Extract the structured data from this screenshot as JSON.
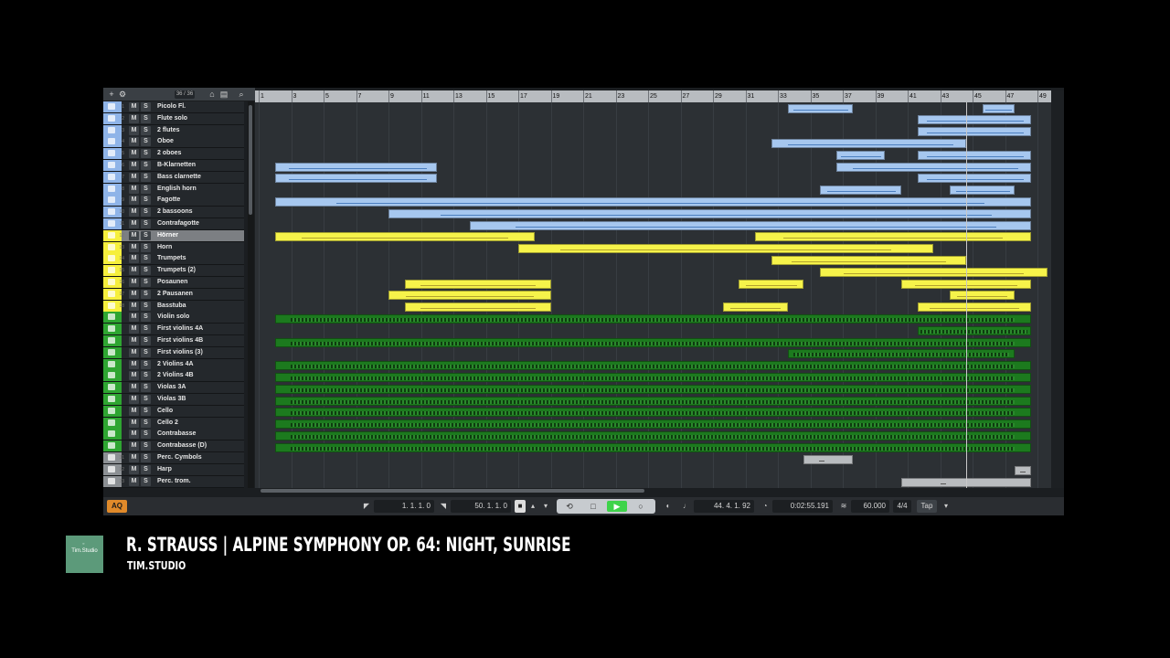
{
  "tracklist": {
    "header": {
      "add_label": "+",
      "track_count": "36 / 36",
      "search_icon": "search-icon"
    },
    "tracks": [
      {
        "num": "1",
        "name": "Picolo Fl.",
        "group": "wood"
      },
      {
        "num": "2",
        "name": "Flute solo",
        "group": "wood"
      },
      {
        "num": "3",
        "name": "2 flutes",
        "group": "wood"
      },
      {
        "num": "4",
        "name": "Oboe",
        "group": "wood"
      },
      {
        "num": "5",
        "name": "2 oboes",
        "group": "wood"
      },
      {
        "num": "6",
        "name": "B-Klarnetten",
        "group": "wood"
      },
      {
        "num": "7",
        "name": "Bass clarnette",
        "group": "wood"
      },
      {
        "num": "8",
        "name": "English horn",
        "group": "wood"
      },
      {
        "num": "9",
        "name": "Fagotte",
        "group": "wood"
      },
      {
        "num": "10",
        "name": "2 bassoons",
        "group": "wood"
      },
      {
        "num": "11",
        "name": "Contrafagotte",
        "group": "wood"
      },
      {
        "num": "12",
        "name": "Hörner",
        "group": "brass",
        "selected": true
      },
      {
        "num": "13",
        "name": "Horn",
        "group": "brass"
      },
      {
        "num": "14",
        "name": "Trumpets",
        "group": "brass"
      },
      {
        "num": "15",
        "name": "Trumpets (2)",
        "group": "brass"
      },
      {
        "num": "16",
        "name": "Posaunen",
        "group": "brass"
      },
      {
        "num": "17",
        "name": "2 Pausanen",
        "group": "brass"
      },
      {
        "num": "18",
        "name": "Basstuba",
        "group": "brass"
      },
      {
        "num": "",
        "name": "Violin solo",
        "group": "str"
      },
      {
        "num": "",
        "name": "First violins 4A",
        "group": "str"
      },
      {
        "num": "",
        "name": "First violins 4B",
        "group": "str"
      },
      {
        "num": "",
        "name": "First violins (3)",
        "group": "str"
      },
      {
        "num": "",
        "name": "2 Violins 4A",
        "group": "str"
      },
      {
        "num": "",
        "name": "2 Violins 4B",
        "group": "str"
      },
      {
        "num": "",
        "name": "Violas 3A",
        "group": "str"
      },
      {
        "num": "",
        "name": "Violas 3B",
        "group": "str"
      },
      {
        "num": "",
        "name": "Cello",
        "group": "str"
      },
      {
        "num": "",
        "name": "Cello 2",
        "group": "str"
      },
      {
        "num": "",
        "name": "Contrabasse",
        "group": "str"
      },
      {
        "num": "",
        "name": "Contrabasse (D)",
        "group": "str"
      },
      {
        "num": "31",
        "name": "Perc. Cymbols",
        "group": "perc"
      },
      {
        "num": "32",
        "name": "Harp",
        "group": "perc"
      },
      {
        "num": "33",
        "name": "Perc. trom.",
        "group": "perc"
      }
    ],
    "mute_label": "M",
    "solo_label": "S"
  },
  "ruler": {
    "bars": [
      "1",
      "3",
      "5",
      "7",
      "9",
      "11",
      "13",
      "15",
      "17",
      "19",
      "21",
      "23",
      "25",
      "27",
      "29",
      "31",
      "33",
      "35",
      "37",
      "39",
      "41",
      "43",
      "45",
      "47",
      "49"
    ],
    "playhead_bar": 44.6
  },
  "events": [
    {
      "track": 0,
      "start": 33.6,
      "end": 37.6
    },
    {
      "track": 0,
      "start": 45.6,
      "end": 47.6
    },
    {
      "track": 1,
      "start": 41.6,
      "end": 48.6
    },
    {
      "track": 2,
      "start": 41.6,
      "end": 48.6
    },
    {
      "track": 3,
      "start": 32.6,
      "end": 44.6
    },
    {
      "track": 4,
      "start": 36.6,
      "end": 39.6
    },
    {
      "track": 4,
      "start": 41.6,
      "end": 48.6
    },
    {
      "track": 5,
      "start": 2.0,
      "end": 12.0
    },
    {
      "track": 5,
      "start": 36.6,
      "end": 48.6
    },
    {
      "track": 6,
      "start": 2.0,
      "end": 12.0
    },
    {
      "track": 6,
      "start": 41.6,
      "end": 48.6
    },
    {
      "track": 7,
      "start": 35.6,
      "end": 40.6
    },
    {
      "track": 7,
      "start": 43.6,
      "end": 47.6
    },
    {
      "track": 8,
      "start": 2.0,
      "end": 48.6
    },
    {
      "track": 9,
      "start": 9.0,
      "end": 48.6
    },
    {
      "track": 10,
      "start": 14.0,
      "end": 48.6
    },
    {
      "track": 11,
      "start": 2.0,
      "end": 18.0
    },
    {
      "track": 11,
      "start": 31.6,
      "end": 48.6
    },
    {
      "track": 12,
      "start": 17.0,
      "end": 42.6
    },
    {
      "track": 13,
      "start": 32.6,
      "end": 44.6
    },
    {
      "track": 14,
      "start": 35.6,
      "end": 49.6
    },
    {
      "track": 15,
      "start": 10.0,
      "end": 19.0
    },
    {
      "track": 15,
      "start": 30.6,
      "end": 34.6
    },
    {
      "track": 15,
      "start": 40.6,
      "end": 48.6
    },
    {
      "track": 16,
      "start": 9.0,
      "end": 19.0
    },
    {
      "track": 16,
      "start": 43.6,
      "end": 47.6
    },
    {
      "track": 17,
      "start": 10.0,
      "end": 19.0
    },
    {
      "track": 17,
      "start": 29.6,
      "end": 33.6
    },
    {
      "track": 17,
      "start": 41.6,
      "end": 48.6
    },
    {
      "track": 18,
      "start": 2.0,
      "end": 48.6
    },
    {
      "track": 19,
      "start": 41.6,
      "end": 48.6
    },
    {
      "track": 20,
      "start": 2.0,
      "end": 48.6
    },
    {
      "track": 21,
      "start": 33.6,
      "end": 47.6
    },
    {
      "track": 22,
      "start": 2.0,
      "end": 48.6
    },
    {
      "track": 23,
      "start": 2.0,
      "end": 48.6
    },
    {
      "track": 24,
      "start": 2.0,
      "end": 48.6
    },
    {
      "track": 25,
      "start": 2.0,
      "end": 48.6
    },
    {
      "track": 26,
      "start": 2.0,
      "end": 48.6
    },
    {
      "track": 27,
      "start": 2.0,
      "end": 48.6
    },
    {
      "track": 28,
      "start": 2.0,
      "end": 48.6
    },
    {
      "track": 29,
      "start": 2.0,
      "end": 48.6
    },
    {
      "track": 30,
      "start": 34.6,
      "end": 37.6
    },
    {
      "track": 31,
      "start": 47.6,
      "end": 48.6
    },
    {
      "track": 32,
      "start": 40.6,
      "end": 48.6
    }
  ],
  "colors": {
    "wood": "#a6c7ef",
    "brass": "#f6f34a",
    "str": "#1c7a1e",
    "perc": "#b9bcbf",
    "wood_strip": "#8fb4e8",
    "brass_strip": "#f6ef3c",
    "str_strip": "#2ea531",
    "perc_strip": "#8c9094"
  },
  "transport": {
    "aq_label": "AQ",
    "left_locator": "1. 1. 1.   0",
    "right_locator": "50. 1. 1.   0",
    "position_bars": "44. 4. 1. 92",
    "position_time": "0:02:55.191",
    "tempo": "60.000",
    "signature": "4/4",
    "tap_label": "Tap"
  },
  "overlay": {
    "logo_text": "Tim.Studio",
    "title": "R. STRAUSS  |  ALPINE SYMPHONY OP. 64: NIGHT, SUNRISE",
    "subtitle": "TIM.STUDIO"
  }
}
